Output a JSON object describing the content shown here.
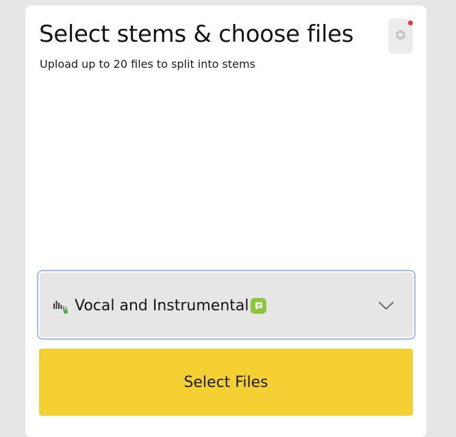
{
  "header": {
    "title": "Select stems & choose files",
    "subtitle": "Upload up to 20 files to split into stems"
  },
  "settings": {
    "icon": "gear-icon",
    "has_notification": true,
    "notification_color": "#e8323c"
  },
  "stem_select": {
    "selected_label": "Vocal and Instrumental",
    "leading_icon": "stems-waveform-icon",
    "badge_icon": "premium-badge-icon",
    "badge_color": "#8cc63f",
    "trailing_icon": "chevron-down-icon"
  },
  "actions": {
    "select_files_label": "Select Files",
    "button_color": "#f5d033"
  }
}
